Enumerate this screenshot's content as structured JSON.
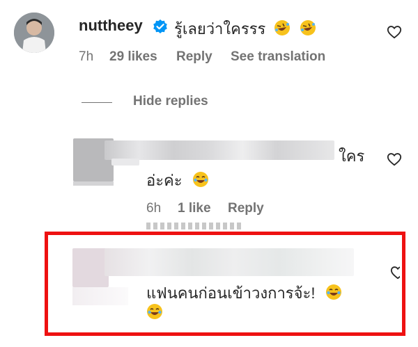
{
  "top_comment": {
    "username": "nuttheey",
    "text": "รู้เลยว่าใครรร",
    "time": "7h",
    "likes": "29 likes",
    "reply": "Reply",
    "see_translation": "See translation",
    "emojis": [
      "rolling-on-floor-laughing",
      "rolling-on-floor-laughing"
    ]
  },
  "hide_replies": "Hide replies",
  "reply1": {
    "text_end": "ใคร",
    "text_line2": "อ่ะค่ะ",
    "time": "6h",
    "likes": "1 like",
    "reply": "Reply",
    "emoji": "face-with-tears-of-joy"
  },
  "reply2": {
    "text": "แฟนคนก่อนเข้าวงการจ้ะ!",
    "emojis": [
      "face-with-tears-of-joy",
      "face-with-tears-of-joy"
    ]
  },
  "colors": {
    "highlight": "#ee1111",
    "verified": "#0095f6",
    "meta_text": "#737373"
  }
}
